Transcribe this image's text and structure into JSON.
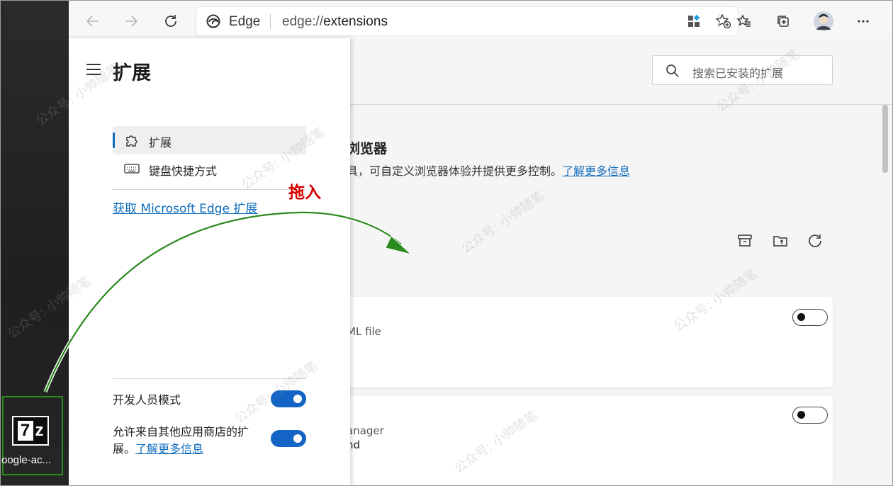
{
  "desktop": {
    "file_icon": "7z-archive-icon",
    "file_name": "oogle-ac..."
  },
  "browser": {
    "nav_icons": [
      "back-icon",
      "forward-icon",
      "refresh-icon"
    ],
    "address": {
      "site_label": "Edge",
      "url_scheme": "edge://",
      "url_path": "extensions"
    },
    "toolbar_icons": [
      "add-favorite-icon",
      "extensions-icon",
      "favorites-icon",
      "collections-icon",
      "profile-avatar",
      "more-icon"
    ]
  },
  "panel": {
    "title": "扩展",
    "nav": [
      {
        "label": "扩展",
        "icon": "puzzle-icon",
        "active": true
      },
      {
        "label": "键盘快捷方式",
        "icon": "keyboard-icon",
        "active": false
      }
    ],
    "get_extensions_link": "获取 Microsoft Edge 扩展",
    "dev_mode_label": "开发人员模式",
    "dev_mode_on": true,
    "allow_other_line1": "允许来自其他应用商店的扩",
    "allow_other_line2": "展。",
    "allow_other_link": "了解更多信息",
    "allow_other_on": true
  },
  "main": {
    "search_placeholder": "搜索已安装的扩展",
    "heading_fragment": "浏览器",
    "desc_fragment": "具，可自定义浏览器体验并提供更多控制。",
    "desc_link": "了解更多信息",
    "actions": [
      "archive-icon",
      "pack-icon",
      "update-icon"
    ],
    "card1": {
      "text": "ML file",
      "enabled": false
    },
    "card2": {
      "text1": "anager",
      "text2": "hd",
      "enabled": false
    }
  },
  "overlay": {
    "drag_label": "拖入",
    "watermark": "公众号: 小帅随笔",
    "colors": {
      "arrow": "#2b8a1e",
      "drag_label": "#d40000",
      "accent": "#0f6cbd",
      "toggle_on": "#1464c6"
    }
  }
}
